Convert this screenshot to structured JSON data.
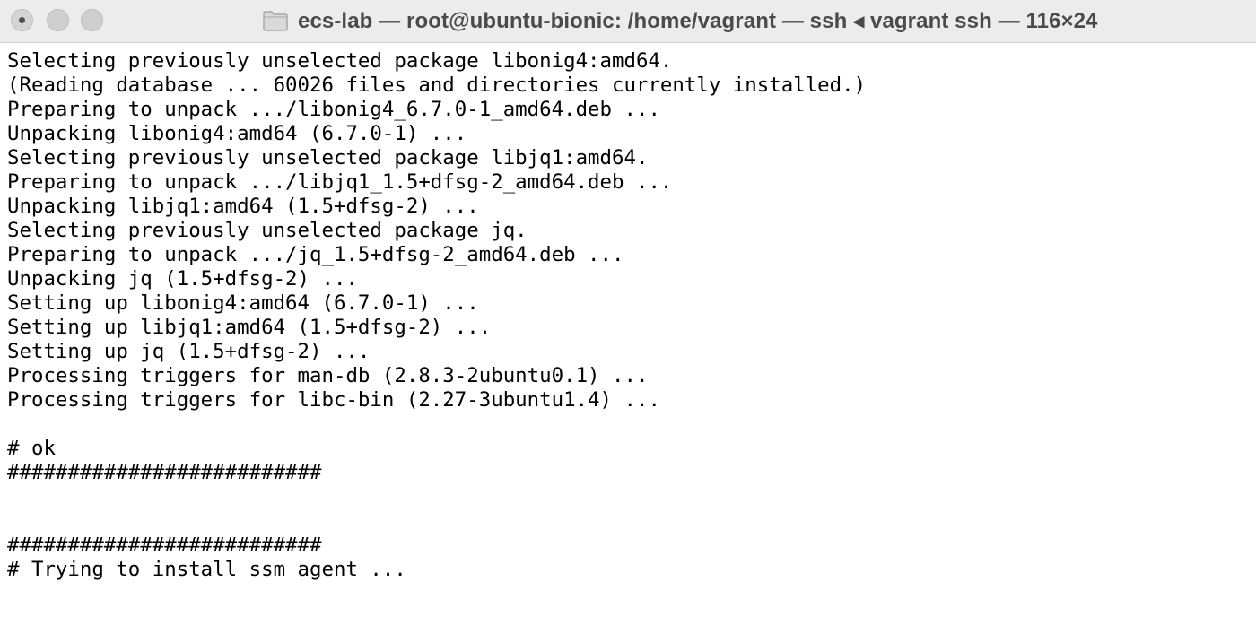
{
  "window": {
    "title": "ecs-lab — root@ubuntu-bionic: /home/vagrant — ssh ◂ vagrant ssh — 116×24",
    "icon": "folder-icon",
    "traffic_lights": [
      "close",
      "minimize",
      "maximize"
    ],
    "colors": {
      "titlebar": "#ececec",
      "title_text": "#4a4a4a",
      "terminal_bg": "#ffffff",
      "terminal_text": "#000000",
      "cursor": "#8c8c8c"
    }
  },
  "terminal": {
    "lines": [
      "Selecting previously unselected package libonig4:amd64.",
      "(Reading database ... 60026 files and directories currently installed.)",
      "Preparing to unpack .../libonig4_6.7.0-1_amd64.deb ...",
      "Unpacking libonig4:amd64 (6.7.0-1) ...",
      "Selecting previously unselected package libjq1:amd64.",
      "Preparing to unpack .../libjq1_1.5+dfsg-2_amd64.deb ...",
      "Unpacking libjq1:amd64 (1.5+dfsg-2) ...",
      "Selecting previously unselected package jq.",
      "Preparing to unpack .../jq_1.5+dfsg-2_amd64.deb ...",
      "Unpacking jq (1.5+dfsg-2) ...",
      "Setting up libonig4:amd64 (6.7.0-1) ...",
      "Setting up libjq1:amd64 (1.5+dfsg-2) ...",
      "Setting up jq (1.5+dfsg-2) ...",
      "Processing triggers for man-db (2.8.3-2ubuntu0.1) ...",
      "Processing triggers for libc-bin (2.27-3ubuntu1.4) ...",
      "",
      "# ok",
      "##########################",
      "",
      "",
      "##########################",
      "# Trying to install ssm agent ...",
      ""
    ]
  }
}
